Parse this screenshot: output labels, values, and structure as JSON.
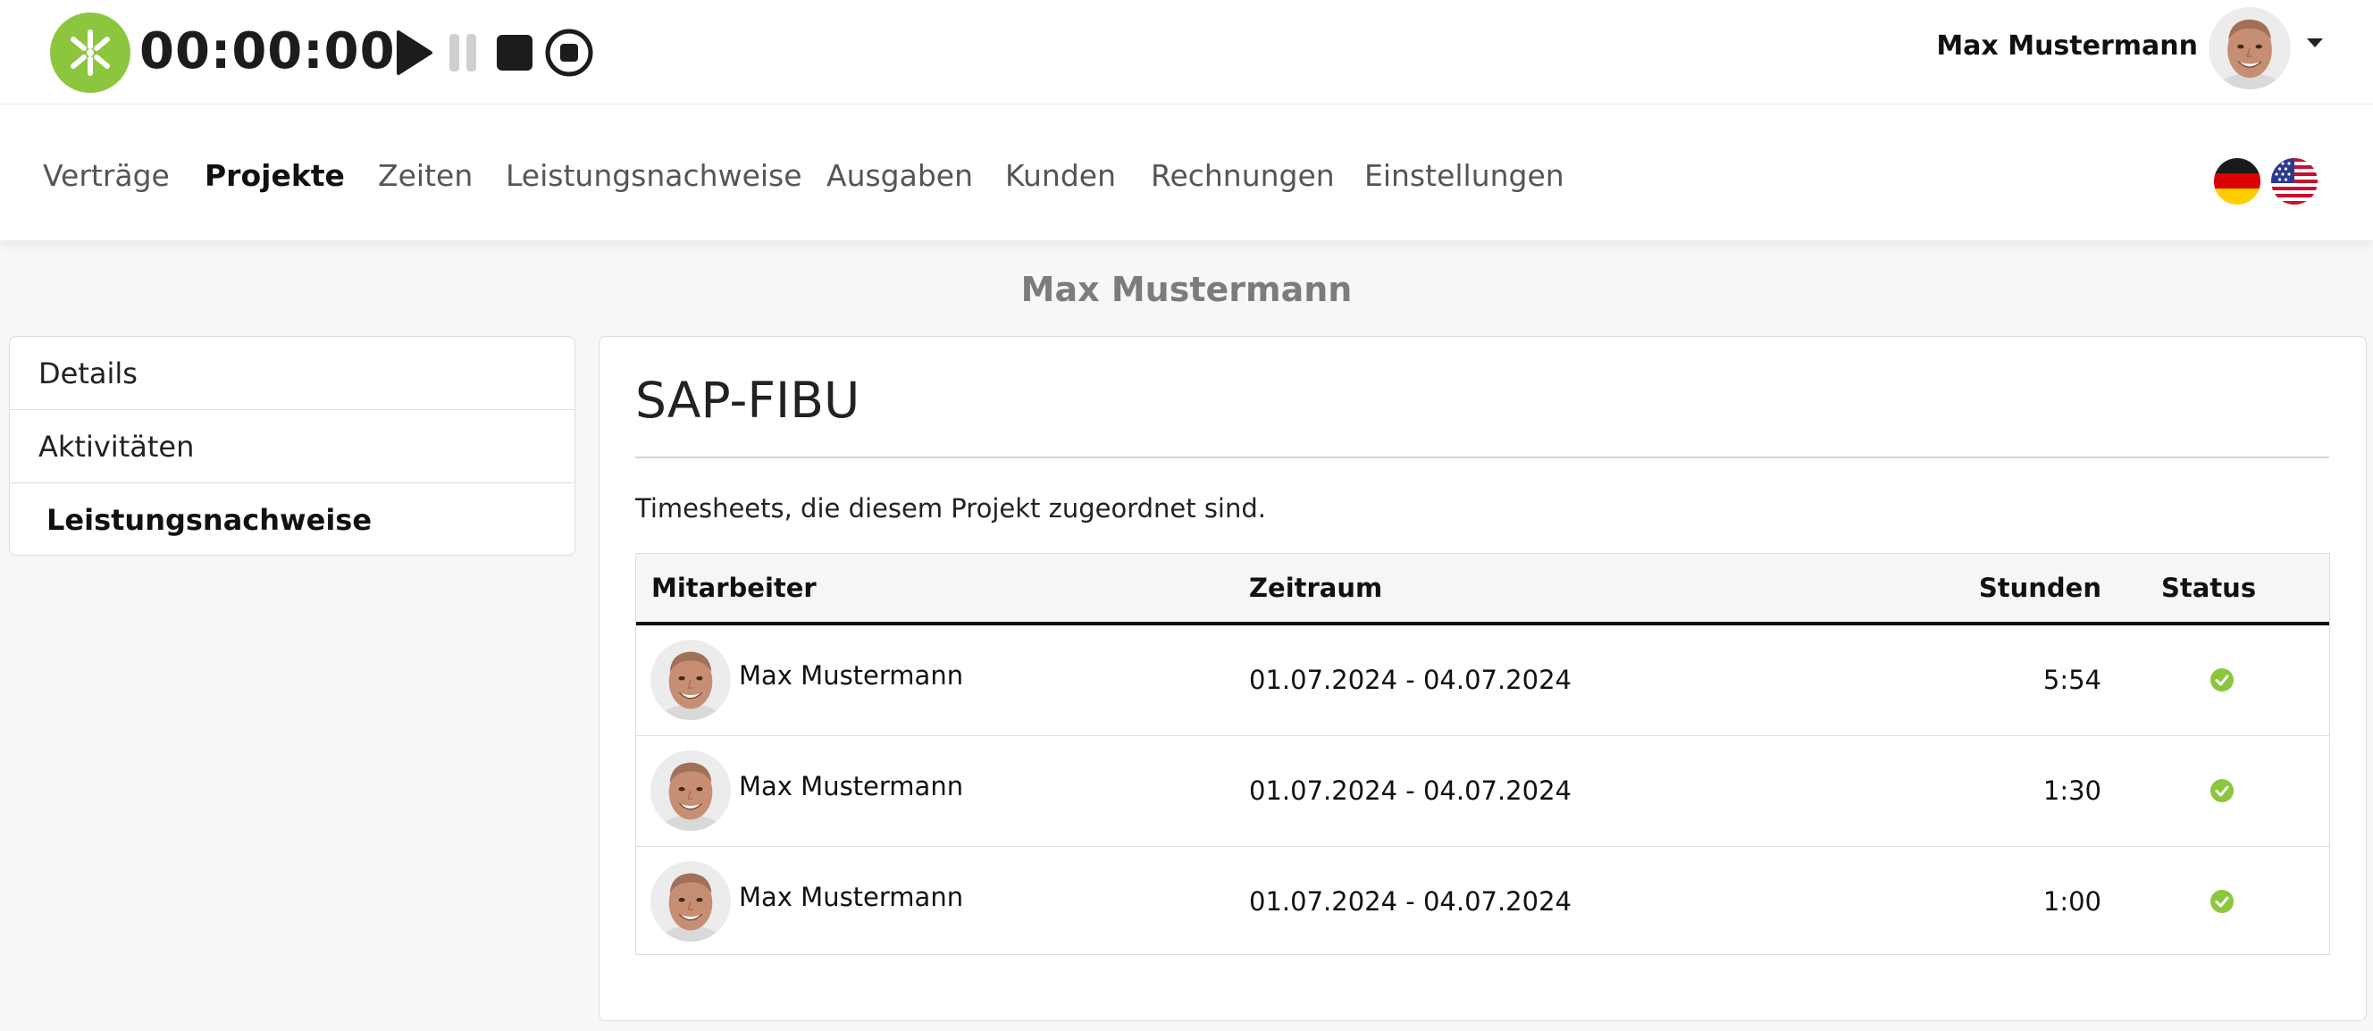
{
  "topbar": {
    "logo_icon": "kimai-logo-icon",
    "timer": "00:00:00",
    "controls": [
      "play-icon",
      "pause-icon",
      "stop-icon",
      "record-stop-icon"
    ],
    "user_name": "Max Mustermann",
    "accent_color": "#8cc63f"
  },
  "nav": {
    "items": [
      {
        "label": "Verträge"
      },
      {
        "label": "Projekte"
      },
      {
        "label": "Zeiten"
      },
      {
        "label": "Leistungsnachweise"
      },
      {
        "label": "Ausgaben"
      },
      {
        "label": "Kunden"
      },
      {
        "label": "Rechnungen"
      },
      {
        "label": "Einstellungen"
      }
    ],
    "active": "Projekte",
    "languages": [
      "german-flag-icon",
      "us-flag-icon"
    ]
  },
  "page": {
    "heading": "Max Mustermann"
  },
  "sidebar": {
    "items": [
      {
        "label": "Details"
      },
      {
        "label": "Aktivitäten"
      },
      {
        "label": "Leistungsnachweise"
      }
    ],
    "active": "Leistungsnachweise"
  },
  "project": {
    "title": "SAP-FIBU",
    "description": "Timesheets, die diesem Projekt zugeordnet sind.",
    "table": {
      "headers": {
        "employee": "Mitarbeiter",
        "period": "Zeitraum",
        "hours": "Stunden",
        "status": "Status"
      },
      "rows": [
        {
          "employee": "Max Mustermann",
          "period": "01.07.2024 - 04.07.2024",
          "hours": "5:54",
          "status": "check-circle-icon"
        },
        {
          "employee": "Max Mustermann",
          "period": "01.07.2024 - 04.07.2024",
          "hours": "1:30",
          "status": "check-circle-icon"
        },
        {
          "employee": "Max Mustermann",
          "period": "01.07.2024 - 04.07.2024",
          "hours": "1:00",
          "status": "check-circle-icon"
        }
      ],
      "status_color": "#8cc63f"
    }
  }
}
